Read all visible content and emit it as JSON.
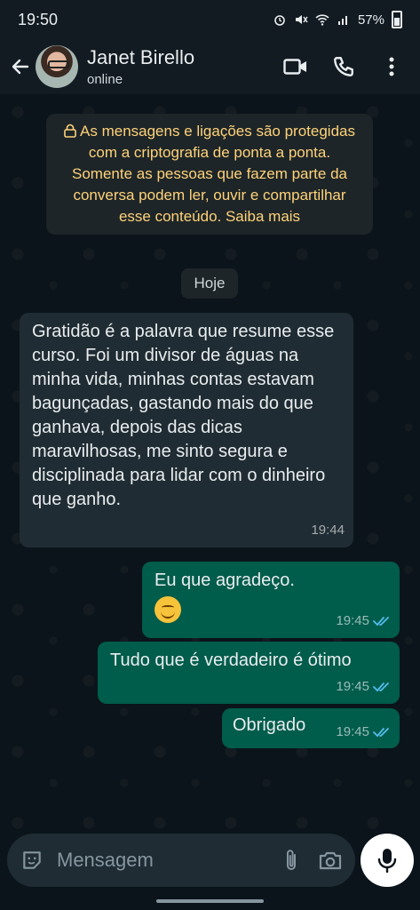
{
  "statusbar": {
    "time": "19:50",
    "battery": "57%"
  },
  "header": {
    "contact_name": "Janet Birello",
    "contact_status": "online"
  },
  "chat": {
    "encryption_notice": "As mensagens e ligações são protegidas com a criptografia de ponta a ponta. Somente as pessoas que fazem parte da conversa podem ler, ouvir e compartilhar esse conteúdo. Saiba mais",
    "day_label": "Hoje",
    "messages": [
      {
        "direction": "incoming",
        "text": "Gratidão é a palavra que resume esse curso. Foi um divisor de águas na minha vida, minhas contas estavam bagunçadas, gastando mais do que ganhava, depois das dicas maravilhosas, me sinto segura  e disciplinada para lidar com o dinheiro que ganho.",
        "time": "19:44"
      },
      {
        "direction": "outgoing",
        "text": "Eu que agradeço.",
        "emoji": "smiling-face-emoji",
        "time": "19:45",
        "status": "read"
      },
      {
        "direction": "outgoing",
        "text": "Tudo que é verdadeiro é ótimo",
        "time": "19:45",
        "status": "read"
      },
      {
        "direction": "outgoing",
        "text": "Obrigado",
        "time": "19:45",
        "status": "read"
      }
    ]
  },
  "composer": {
    "placeholder": "Mensagem"
  },
  "colors": {
    "background": "#0b141a",
    "incoming_bubble": "#202c33",
    "outgoing_bubble": "#005c4b",
    "read_ticks": "#53bdeb",
    "encryption_text": "#ffd279"
  }
}
